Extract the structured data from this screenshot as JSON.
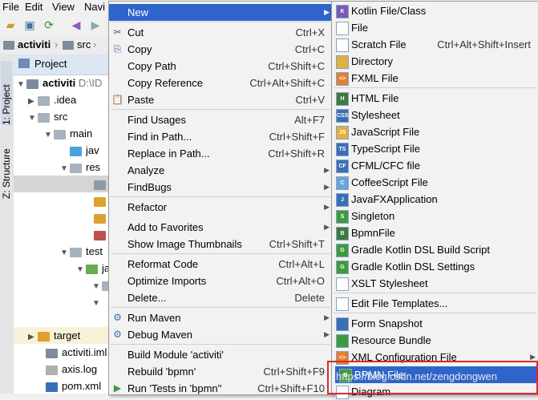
{
  "menubar": [
    "File",
    "Edit",
    "View",
    "Navi"
  ],
  "breadcrumb": {
    "project": "activiti",
    "folder": "src"
  },
  "sidebar_tabs": [
    "1: Project",
    "Z: Structure"
  ],
  "project_panel": {
    "title": "Project",
    "root": "activiti",
    "root_path": "D:\\ID",
    "items": [
      ".idea",
      "src",
      "main",
      "jav",
      "res",
      "test",
      "jav",
      "target",
      "activiti.iml",
      "axis.log",
      "pom.xml"
    ]
  },
  "context_menu": {
    "items": [
      {
        "label": "New",
        "shortcut": "",
        "submenu": true,
        "highlight": true
      },
      {
        "label": "Cut",
        "shortcut": "Ctrl+X",
        "icon": "scissors-icon"
      },
      {
        "label": "Copy",
        "shortcut": "Ctrl+C",
        "icon": "copy-icon"
      },
      {
        "label": "Copy Path",
        "shortcut": "Ctrl+Shift+C"
      },
      {
        "label": "Copy Reference",
        "shortcut": "Ctrl+Alt+Shift+C"
      },
      {
        "label": "Paste",
        "shortcut": "Ctrl+V",
        "icon": "paste-icon"
      },
      {
        "label": "Find Usages",
        "shortcut": "Alt+F7"
      },
      {
        "label": "Find in Path...",
        "shortcut": "Ctrl+Shift+F"
      },
      {
        "label": "Replace in Path...",
        "shortcut": "Ctrl+Shift+R"
      },
      {
        "label": "Analyze",
        "submenu": true
      },
      {
        "label": "FindBugs",
        "submenu": true
      },
      {
        "label": "Refactor",
        "submenu": true
      },
      {
        "label": "Add to Favorites",
        "submenu": true
      },
      {
        "label": "Show Image Thumbnails",
        "shortcut": "Ctrl+Shift+T"
      },
      {
        "label": "Reformat Code",
        "shortcut": "Ctrl+Alt+L"
      },
      {
        "label": "Optimize Imports",
        "shortcut": "Ctrl+Alt+O"
      },
      {
        "label": "Delete...",
        "shortcut": "Delete"
      },
      {
        "label": "Run Maven",
        "submenu": true,
        "icon": "gear-icon"
      },
      {
        "label": "Debug Maven",
        "submenu": true,
        "icon": "gear-icon"
      },
      {
        "label": "Build Module 'activiti'"
      },
      {
        "label": "Rebuild 'bpmn'",
        "shortcut": "Ctrl+Shift+F9"
      },
      {
        "label": "Run 'Tests in 'bpmn''",
        "shortcut": "Ctrl+Shift+F10",
        "icon": "run-icon"
      }
    ]
  },
  "new_submenu": {
    "items": [
      {
        "label": "Kotlin File/Class"
      },
      {
        "label": "File"
      },
      {
        "label": "Scratch File",
        "shortcut": "Ctrl+Alt+Shift+Insert"
      },
      {
        "label": "Directory"
      },
      {
        "label": "FXML File"
      },
      {
        "label": "HTML File"
      },
      {
        "label": "Stylesheet"
      },
      {
        "label": "JavaScript File"
      },
      {
        "label": "TypeScript File"
      },
      {
        "label": "CFML/CFC file"
      },
      {
        "label": "CoffeeScript File"
      },
      {
        "label": "JavaFXApplication"
      },
      {
        "label": "Singleton"
      },
      {
        "label": "BpmnFile"
      },
      {
        "label": "Gradle Kotlin DSL Build Script"
      },
      {
        "label": "Gradle Kotlin DSL Settings"
      },
      {
        "label": "XSLT Stylesheet"
      },
      {
        "label": "Edit File Templates..."
      },
      {
        "label": "Form Snapshot"
      },
      {
        "label": "Resource Bundle"
      },
      {
        "label": "XML Configuration File",
        "submenu": true
      },
      {
        "label": "BPMN File",
        "highlight": true
      },
      {
        "label": "Diagram"
      }
    ]
  },
  "watermark": "https://blog.csdn.net/zengdongwen",
  "colors": {
    "highlight": "#2f65ca",
    "annotation": "#e3262b"
  }
}
